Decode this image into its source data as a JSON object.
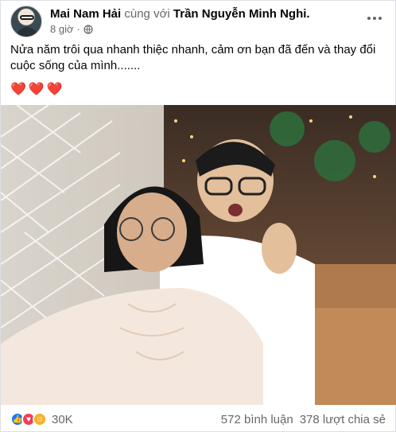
{
  "post": {
    "author": "Mai Nam Hải",
    "with_word": "cùng với",
    "tagged": "Trần Nguyễn Minh Nghi",
    "time": "8 giờ",
    "text": "Nửa năm trôi qua nhanh thiệc nhanh, cảm ơn bạn đã đến và thay đổi cuộc sống của mình.......",
    "hearts": "❤️❤️❤️"
  },
  "icons": {
    "privacy": "globe-icon",
    "more": "more-options-icon",
    "reactions": [
      "like-icon",
      "love-icon",
      "haha-icon"
    ]
  },
  "stats": {
    "reactions": "30K",
    "comments": "572 bình luận",
    "shares": "378 lượt chia sẻ"
  },
  "colors": {
    "link": "#050505",
    "secondary": "#65676b",
    "like": "#1877f2",
    "love": "#f33e58",
    "haha": "#f7b125"
  }
}
